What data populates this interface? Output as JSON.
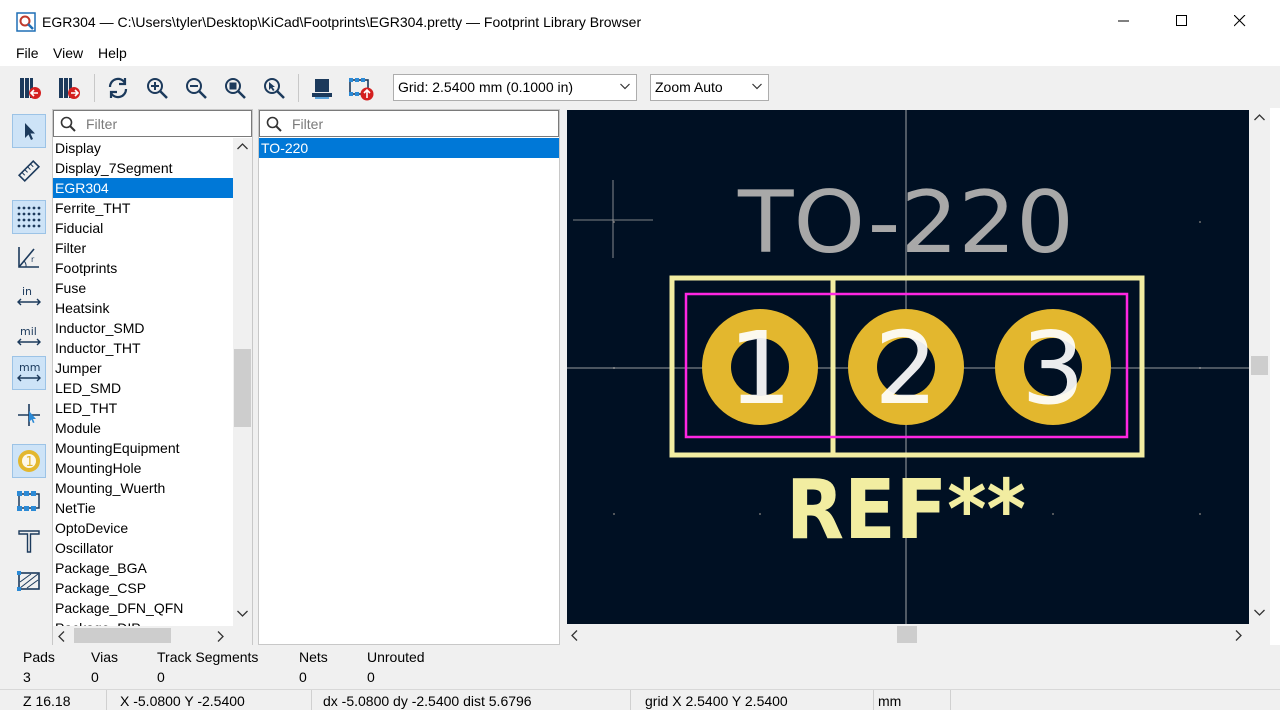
{
  "window": {
    "title": "EGR304 — C:\\Users\\tyler\\Desktop\\KiCad\\Footprints\\EGR304.pretty — Footprint Library Browser"
  },
  "menu": [
    "File",
    "View",
    "Help"
  ],
  "toolbar": {
    "grid_value": "Grid: 2.5400 mm (0.1000 in)",
    "zoom_value": "Zoom Auto"
  },
  "left_tools": {
    "units_in": "in",
    "units_mil": "mil",
    "units_mm": "mm"
  },
  "libraries": {
    "filter_placeholder": "Filter",
    "selected": "EGR304",
    "items": [
      "Display",
      "Display_7Segment",
      "EGR304",
      "Ferrite_THT",
      "Fiducial",
      "Filter",
      "Footprints",
      "Fuse",
      "Heatsink",
      "Inductor_SMD",
      "Inductor_THT",
      "Jumper",
      "LED_SMD",
      "LED_THT",
      "Module",
      "MountingEquipment",
      "MountingHole",
      "Mounting_Wuerth",
      "NetTie",
      "OptoDevice",
      "Oscillator",
      "Package_BGA",
      "Package_CSP",
      "Package_DFN_QFN",
      "Package_DIP"
    ]
  },
  "footprints": {
    "filter_placeholder": "Filter",
    "items": [
      "TO-220"
    ],
    "selected": "TO-220"
  },
  "canvas": {
    "value_text": "TO-220",
    "reference_text": "REF**",
    "pads": [
      "1",
      "2",
      "3"
    ],
    "colors": {
      "background": "#001023",
      "value": "#a8a8a8",
      "silkscreen": "#f2eda1",
      "courtyard": "#ff26e2",
      "pad": "#e3b72e",
      "pad_number": "#ffffff"
    }
  },
  "messages": {
    "labels": [
      "Pads",
      "Vias",
      "Track Segments",
      "Nets",
      "Unrouted"
    ],
    "values": [
      "3",
      "0",
      "0",
      "0",
      "0"
    ]
  },
  "status": {
    "zoom": "Z 16.18",
    "xy": "X -5.0800  Y -2.5400",
    "delta": "dx -5.0800  dy -2.5400  dist 5.6796",
    "grid": "grid X 2.5400  Y 2.5400",
    "units": "mm"
  }
}
